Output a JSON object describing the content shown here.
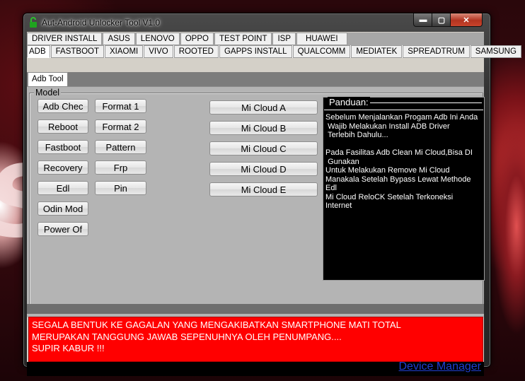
{
  "window": {
    "title": "Aut-Android Unlocker Tool V1.0",
    "controls": {
      "minimize": "▬",
      "maximize": "▢",
      "close": "✕"
    }
  },
  "tabs_row1": [
    "DRIVER INSTALL",
    "ASUS",
    "LENOVO",
    "OPPO",
    "TEST POINT",
    "ISP",
    "HUAWEI"
  ],
  "tabs_row2": [
    "ADB",
    "FASTBOOT",
    "XIAOMI",
    "VIVO",
    "ROOTED",
    "GAPPS INSTALL",
    "QUALCOMM",
    "MEDIATEK",
    "SPREADTRUM",
    "SAMSUNG"
  ],
  "active_tab": "ADB",
  "subtab": "Adb Tool",
  "model_group": {
    "label": "Model",
    "left_column": [
      "Adb Chec",
      "Reboot",
      "Fastboot",
      "Recovery",
      "Edl",
      "Odin Mod",
      "Power Of"
    ],
    "right_column": [
      "Format 1",
      "Format 2",
      "Pattern",
      "Frp",
      "Pin"
    ],
    "mi_cloud": [
      "Mi Cloud A",
      "Mi Cloud B",
      "Mi Cloud C",
      "Mi Cloud D",
      "Mi Cloud E"
    ]
  },
  "panduan": {
    "title": "Panduan:",
    "text": "Sebelum Menjalankan Progam Adb Ini Anda\n Wajib Melakukan Install ADB Driver\n Terlebih Dahulu...\n\nPada Fasilitas Adb Clean Mi Cloud,Bisa DI\n Gunakan\nUntuk Melakukan Remove Mi Cloud\nManakala Setelah Bypass Lewat Methode Edl\nMi Cloud ReloCK Setelah Terkoneksi Internet"
  },
  "warning": {
    "text": "SEGALA BENTUK KE GAGALAN YANG MENGAKIBATKAN SMARTPHONE MATI TOTAL\nMERUPAKAN TANGGUNG JAWAB SEPENUHNYA OLEH PENUMPANG....\nSUPIR KABUR !!!"
  },
  "footer": {
    "device_manager": "Device Manager"
  },
  "colors": {
    "warning_bg": "#ff0000",
    "link": "#1f3fd1",
    "panel": "#b4b4b4"
  },
  "icons": {
    "app": "padlock-icon"
  }
}
